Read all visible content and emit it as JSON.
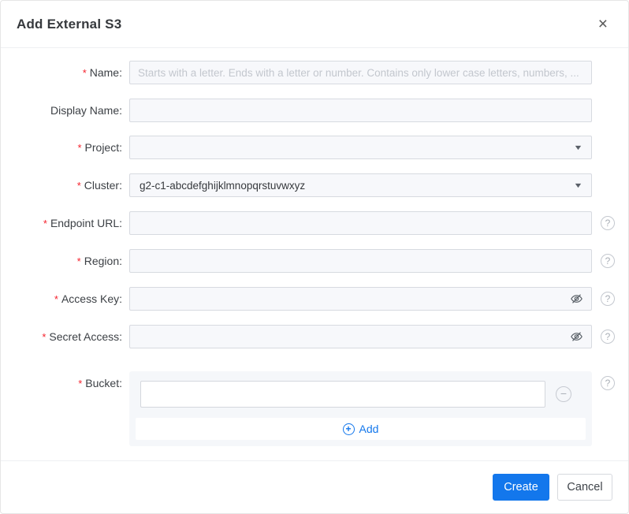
{
  "modal": {
    "title": "Add External S3",
    "close_icon": "×"
  },
  "form": {
    "required_marker": "*",
    "label_suffix": ":",
    "fields": {
      "name": {
        "label": "Name",
        "required": true,
        "value": "",
        "placeholder": "Starts with a letter. Ends with a letter or number. Contains only lower case letters, numbers, ..."
      },
      "display_name": {
        "label": "Display Name",
        "required": false,
        "value": "",
        "placeholder": ""
      },
      "project": {
        "label": "Project",
        "required": true,
        "selected_value": ""
      },
      "cluster": {
        "label": "Cluster",
        "required": true,
        "selected_value": "g2-c1-abcdefghijklmnopqrstuvwxyz"
      },
      "endpoint_url": {
        "label": "Endpoint URL",
        "required": true,
        "value": "",
        "placeholder": "",
        "has_help": true
      },
      "region": {
        "label": "Region",
        "required": true,
        "value": "",
        "placeholder": "",
        "has_help": true
      },
      "access_key": {
        "label": "Access Key",
        "required": true,
        "value": "",
        "placeholder": "",
        "has_help": true
      },
      "secret_access": {
        "label": "Secret Access",
        "required": true,
        "value": "",
        "placeholder": "",
        "has_help": true
      },
      "bucket": {
        "label": "Bucket",
        "required": true,
        "has_help": true,
        "items": [
          {
            "value": "",
            "placeholder": ""
          }
        ],
        "add_label": "Add"
      }
    }
  },
  "icons": {
    "caret_down": "▼",
    "help": "?",
    "minus": "−",
    "plus": "+"
  },
  "footer": {
    "create_label": "Create",
    "cancel_label": "Cancel"
  },
  "colors": {
    "accent_blue": "#1377ec",
    "required_red": "#f5222d",
    "input_background": "#f7f8fb",
    "input_border": "#d7dae0",
    "bucket_panel_background": "#f5f7fa"
  }
}
